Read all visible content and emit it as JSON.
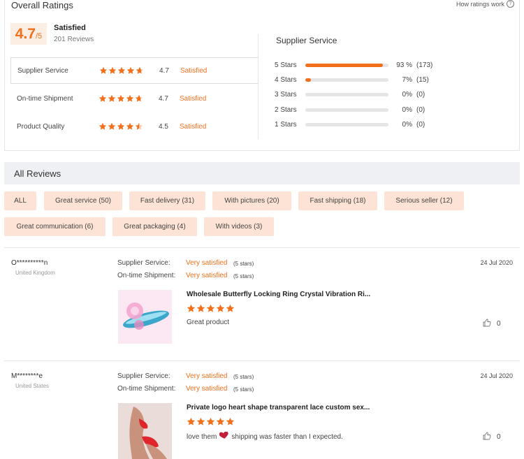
{
  "overall": {
    "title": "Overall Ratings",
    "how_link": "How ratings work",
    "score": "4.7",
    "score_out_of": "/5",
    "summary": "Satisfied",
    "reviews_count": "201 Reviews"
  },
  "ratings": [
    {
      "label": "Supplier Service",
      "value": "4.7",
      "status": "Satisfied",
      "stars": 4.7
    },
    {
      "label": "On-time Shipment",
      "value": "4.7",
      "status": "Satisfied",
      "stars": 4.7
    },
    {
      "label": "Product Quality",
      "value": "4.5",
      "status": "Satisfied",
      "stars": 4.5
    }
  ],
  "supplier_service": {
    "title": "Supplier Service",
    "rows": [
      {
        "label": "5 Stars",
        "pct": "93 %",
        "count": "(173)",
        "fraction": 0.93
      },
      {
        "label": "4 Stars",
        "pct": "7%",
        "count": "(15)",
        "fraction": 0.07
      },
      {
        "label": "3 Stars",
        "pct": "0%",
        "count": "(0)",
        "fraction": 0
      },
      {
        "label": "2 Stars",
        "pct": "0%",
        "count": "(0)",
        "fraction": 0
      },
      {
        "label": "1 Stars",
        "pct": "0%",
        "count": "(0)",
        "fraction": 0
      }
    ]
  },
  "all_reviews": {
    "title": "All Reviews",
    "tags": [
      "ALL",
      "Great service (50)",
      "Fast delivery (31)",
      "With pictures (20)",
      "Fast shipping (18)",
      "Serious seller (12)",
      "Great communication (6)",
      "Great packaging (4)",
      "With videos (3)"
    ]
  },
  "reviews": [
    {
      "user": "O**********n",
      "country": "United Kingdom",
      "supplier_key": "Supplier Service:",
      "supplier_val": "Very satisfied",
      "supplier_stars": "(5 stars)",
      "shipment_key": "On-time Shipment:",
      "shipment_val": "Very satisfied",
      "shipment_stars": "(5 stars)",
      "date": "24 Jul 2020",
      "product": "Wholesale Butterfly Locking Ring Crystal Vibration Ri...",
      "comment": "Great product",
      "likes": "0"
    },
    {
      "user": "M********e",
      "country": "United States",
      "supplier_key": "Supplier Service:",
      "supplier_val": "Very satisfied",
      "supplier_stars": "(5 stars)",
      "shipment_key": "On-time Shipment:",
      "shipment_val": "Very satisfied",
      "shipment_stars": "(5 stars)",
      "date": "24 Jul 2020",
      "product": "Private logo heart shape transparent lace custom sex...",
      "comment_a": "love them",
      "comment_b": "shipping was faster than I expected.",
      "likes": "0"
    }
  ],
  "colors": {
    "accent": "#f2701c",
    "tag_bg": "#fde3d5",
    "header_bg": "#eef0f3"
  },
  "icons": [
    "question-icon",
    "star-icon",
    "thumbs-up-icon",
    "heart-emoji-icon"
  ]
}
